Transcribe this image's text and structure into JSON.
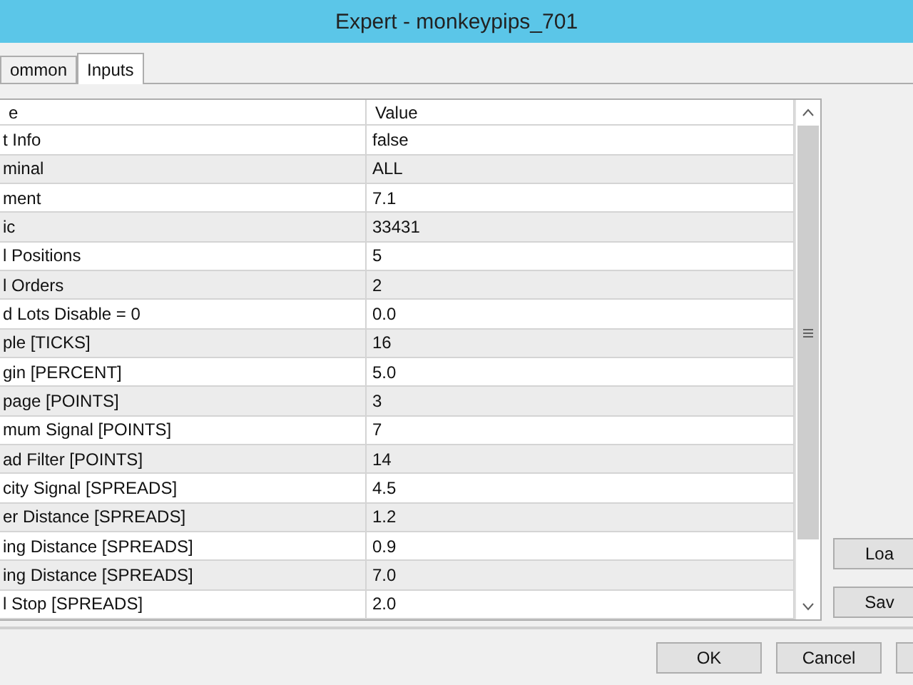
{
  "window": {
    "title": "Expert - monkeypips_701"
  },
  "tabs": [
    {
      "label": "ommon",
      "selected": false
    },
    {
      "label": "Inputs",
      "selected": true
    }
  ],
  "table": {
    "columns": [
      "e",
      "Value"
    ],
    "rows": [
      [
        "t Info",
        "false"
      ],
      [
        "minal",
        "ALL"
      ],
      [
        "ment",
        "7.1"
      ],
      [
        "ic",
        "33431"
      ],
      [
        "l Positions",
        "5"
      ],
      [
        "l Orders",
        "2"
      ],
      [
        "d Lots Disable = 0",
        "0.0"
      ],
      [
        "ple [TICKS]",
        "16"
      ],
      [
        "gin [PERCENT]",
        "5.0"
      ],
      [
        "page [POINTS]",
        "3"
      ],
      [
        "mum Signal [POINTS]",
        "7"
      ],
      [
        "ad Filter [POINTS]",
        "14"
      ],
      [
        "city Signal [SPREADS]",
        "4.5"
      ],
      [
        "er Distance [SPREADS]",
        "1.2"
      ],
      [
        "ing Distance [SPREADS]",
        "0.9"
      ],
      [
        "ing Distance [SPREADS]",
        "7.0"
      ],
      [
        "l Stop [SPREADS]",
        "2.0"
      ]
    ]
  },
  "side_buttons": [
    "Loa",
    "Sav"
  ],
  "bottom_buttons": [
    "OK",
    "Cancel"
  ]
}
